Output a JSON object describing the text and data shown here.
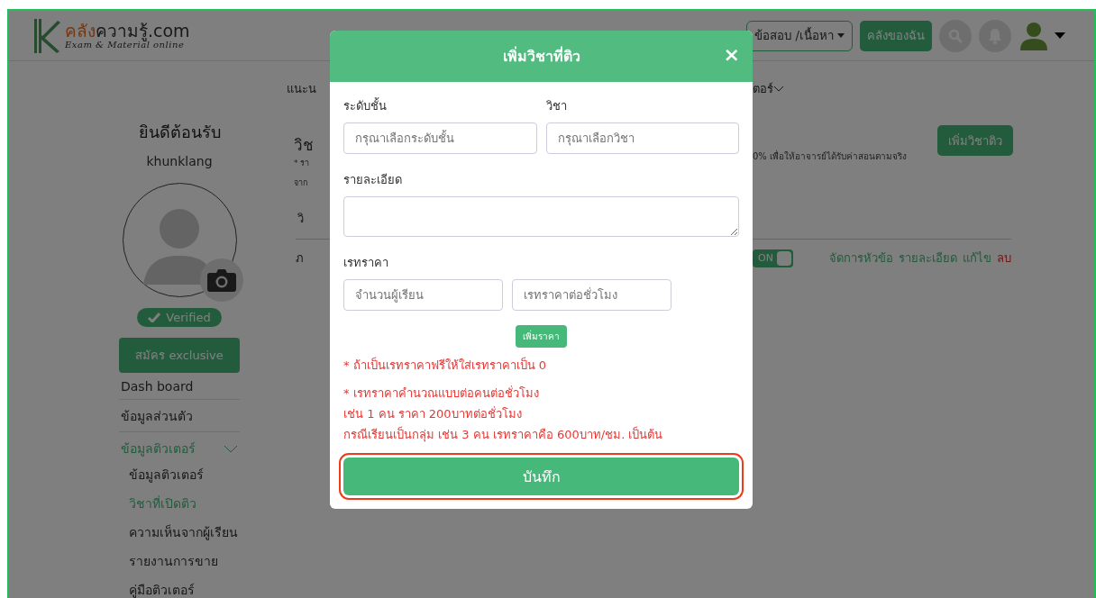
{
  "header": {
    "logo": {
      "brand_first": "คลัง",
      "brand_rest": "ความรู้.com",
      "tagline": "Exam & Material online"
    },
    "manage_button": "ข้อสอบ /เนื้อหา",
    "library_button": "คลังของฉัน"
  },
  "sidebar": {
    "welcome": "ยินดีต้อนรับ",
    "username": "khunklang",
    "verified_badge": "Verified",
    "exclusive_button": "สมัคร exclusive",
    "items": [
      {
        "label": "Dash board",
        "selected": false
      },
      {
        "label": "ข้อมูลส่วนตัว",
        "selected": false
      },
      {
        "label": "ข้อมูลติวเตอร์",
        "selected": true,
        "expanded": true,
        "children": [
          {
            "label": "ข้อมูลติวเตอร์",
            "selected": false
          },
          {
            "label": "วิชาที่เปิดติว",
            "selected": true
          },
          {
            "label": "ความเห็นจากผู้เรียน",
            "selected": false
          },
          {
            "label": "รายงานการขาย",
            "selected": false
          },
          {
            "label": "คู่มือติวเตอร์",
            "selected": false
          }
        ]
      }
    ]
  },
  "main": {
    "nav_left": "แนะน",
    "nav_right": "ตอร์",
    "heading": "วิช",
    "note_1_left": "* รา",
    "note_1_right": "0% เพื่อให้อาจารย์ได้รับค่าสอนตามจริง",
    "note_2_left": "จาก",
    "add_subject_button": "เพิ่มวิชาติว",
    "column_1": "วิ",
    "row": {
      "cell_1": "ภ",
      "toggle": {
        "label": "ON",
        "on": true
      },
      "links": [
        {
          "label": "จัดการหัวข้อ",
          "kind": "normal"
        },
        {
          "label": "รายละเอียด",
          "kind": "normal"
        },
        {
          "label": "แก้ไข",
          "kind": "normal"
        },
        {
          "label": "ลบ",
          "kind": "danger"
        }
      ]
    }
  },
  "modal": {
    "title": "เพิ่มวิชาที่ติว",
    "close": "×",
    "level_label": "ระดับชั้น",
    "level_placeholder": "กรุณาเลือกระดับชั้น",
    "subject_label": "วิชา",
    "subject_placeholder": "กรุณาเลือกวิชา",
    "detail_label": "รายละเอียด",
    "rate_label": "เรทราคา",
    "students_placeholder": "จำนวนผู้เรียน",
    "rate_placeholder": "เรทราคาต่อชั่วโมง",
    "add_rate_button": "เพิ่มราคา",
    "notes": [
      "* ถ้าเป็นเรทราคาฟรีให้ใส่เรทราคาเป็น 0",
      "* เรทราคาคำนวณแบบต่อคนต่อชั่วโมง\nเช่น 1 คน ราคา 200บาทต่อชั่วโมง\nกรณีเรียนเป็นกลุ่ม เช่น 3 คน เรทราคาคือ 600บาท/ชม. เป็นต้น"
    ],
    "save_button": "บันทึก"
  }
}
